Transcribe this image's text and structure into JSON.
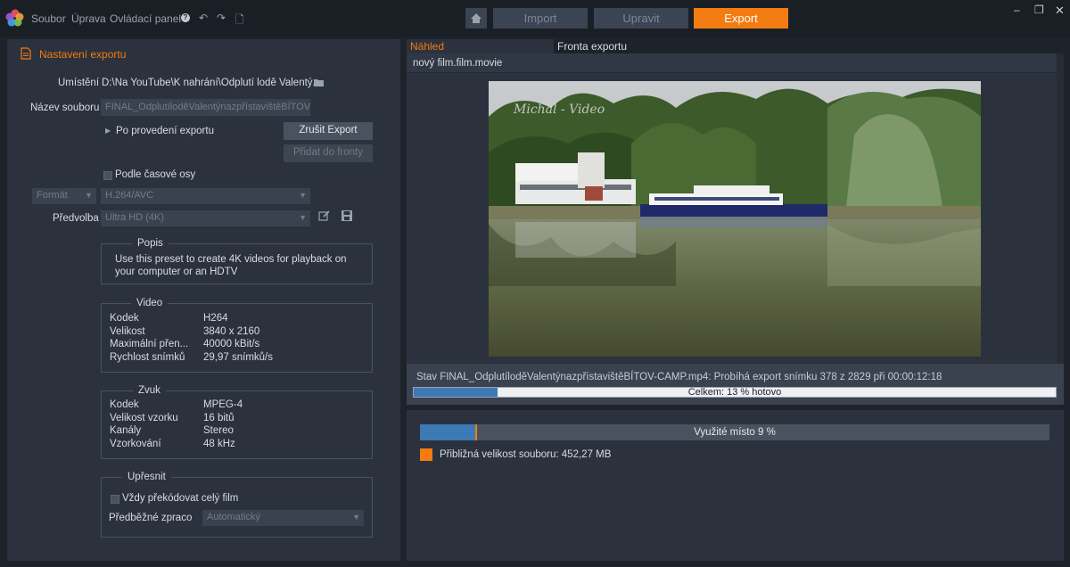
{
  "menu": {
    "file": "Soubor",
    "edit": "Úprava",
    "control_panel": "Ovládací panel",
    "help_icon": "?"
  },
  "nav": {
    "import": "Import",
    "edit": "Upravit",
    "export": "Export"
  },
  "colors": {
    "accent": "#f27c11",
    "progress": "#3d7ab5",
    "panel": "#2b323d"
  },
  "settings": {
    "header": "Nastavení exportu",
    "location_label": "Umístění",
    "location_value": "D:\\Na YouTube\\K nahrání\\Odplutí lodě Valentý...",
    "filename_label": "Název souboru",
    "filename_value": "FINAL_OdplutíloděValentýnazpřístavištěBÍTOV",
    "after_export": "Po provedení exportu",
    "cancel_export": "Zrušit Export",
    "add_to_queue": "Přidat do fronty",
    "timeline_label": "Podle časové osy",
    "format_label": "Formát",
    "format_value": "H.264/AVC",
    "preset_label": "Předvolba",
    "preset_value": "Ultra HD (4K)"
  },
  "description": {
    "title": "Popis",
    "text": "Use this preset to create 4K videos for playback on your computer or an HDTV"
  },
  "video": {
    "title": "Video",
    "rows": [
      {
        "k": "Kodek",
        "v": "H264"
      },
      {
        "k": "Velikost",
        "v": "3840 x 2160"
      },
      {
        "k": "Maximální přen...",
        "v": "40000 kBit/s"
      },
      {
        "k": "Rychlost snímků",
        "v": "29,97 snímků/s"
      }
    ]
  },
  "audio": {
    "title": "Zvuk",
    "rows": [
      {
        "k": "Kodek",
        "v": "MPEG-4"
      },
      {
        "k": "Velikost vzorku",
        "v": "16 bitů"
      },
      {
        "k": "Kanály",
        "v": "Stereo"
      },
      {
        "k": "Vzorkování",
        "v": "48 kHz"
      }
    ]
  },
  "refine": {
    "title": "Upřesnit",
    "always_transcode": "Vždy překódovat celý film",
    "prerender_label": "Předběžné zpraco",
    "prerender_value": "Automatický"
  },
  "preview": {
    "tab_preview": "Náhled",
    "tab_queue": "Fronta exportu",
    "movie_name": "nový film.film.movie",
    "watermark": "Michal - Video",
    "status": "Stav FINAL_OdplutíloděValentýnazpřístavištěBÍTOV-CAMP.mp4: Probíhá export snímku 378 z 2829 při 00:00:12:18",
    "total_label": "Celkem: 13 % hotovo",
    "total_progress": 0.13
  },
  "disk": {
    "used_label": "Využité místo 9 %",
    "used_progress": 0.09,
    "size_label": "Přibližná velikost souboru: 452,27 MB"
  }
}
